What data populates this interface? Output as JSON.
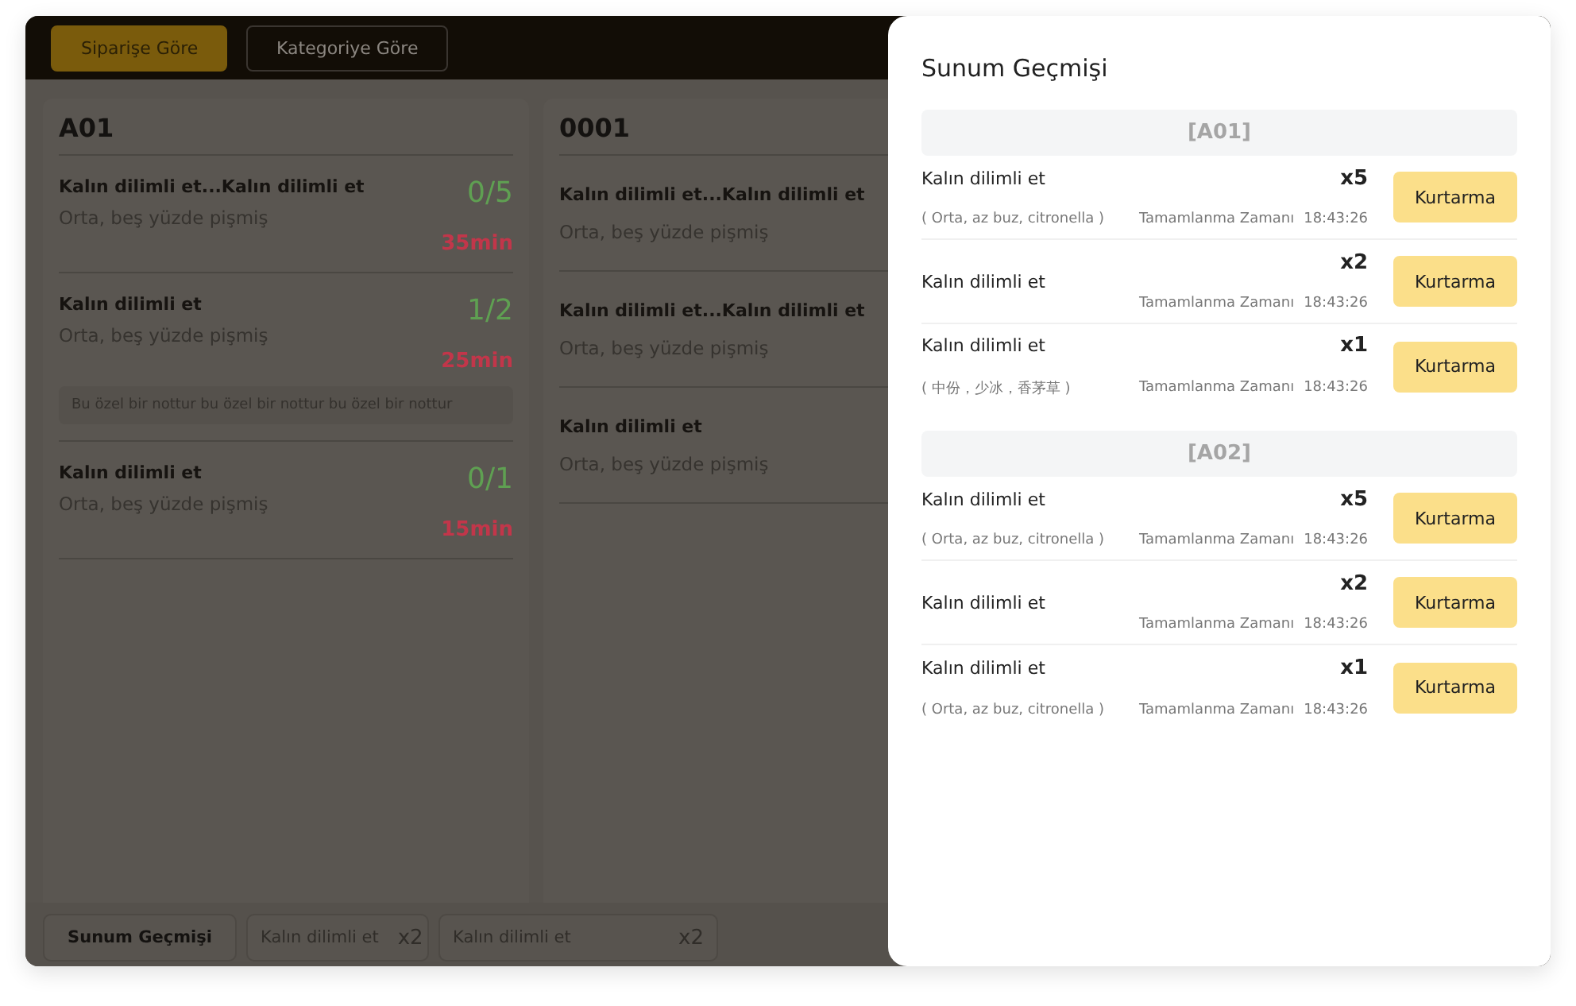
{
  "tabs": [
    {
      "label": "Siparişe Göre",
      "selected": true
    },
    {
      "label": "Kategoriye Göre",
      "selected": false
    }
  ],
  "orders": [
    {
      "title": "A01",
      "items": [
        {
          "name": "Kalın dilimli et...Kalın dilimli et",
          "desc": "Orta, beş yüzde pişmiş",
          "count": "0/5",
          "time": "35min"
        },
        {
          "name": "Kalın dilimli et",
          "desc": "Orta, beş yüzde pişmiş",
          "count": "1/2",
          "time": "25min",
          "note": "Bu özel bir nottur bu özel bir nottur bu özel bir nottur"
        },
        {
          "name": "Kalın dilimli et",
          "desc": "Orta, beş yüzde pişmiş",
          "count": "0/1",
          "time": "15min"
        }
      ]
    },
    {
      "title": "0001",
      "items": [
        {
          "name": "Kalın dilimli et...Kalın dilimli et",
          "desc": "Orta, beş yüzde pişmiş"
        },
        {
          "name": "Kalın dilimli et...Kalın dilimli et",
          "desc": "Orta, beş yüzde pişmiş"
        },
        {
          "name": "Kalın dilimli et",
          "desc": "Orta, beş yüzde pişmiş"
        }
      ]
    }
  ],
  "bottom_bar": {
    "history_button": "Sunum Geçmişi",
    "chips": [
      {
        "name": "Kalın dilimli et",
        "qty": "x2"
      },
      {
        "name": "Kalın dilimli et",
        "qty": "x2"
      }
    ]
  },
  "history": {
    "title": "Sunum Geçmişi",
    "groups": [
      {
        "table": "[A01]",
        "rows": [
          {
            "name": "Kalın dilimli et",
            "options": "( Orta, az buz, citronella )",
            "qty": "x5",
            "time_label": "Tamamlanma Zamanı",
            "time": "18:43:26",
            "button": "Kurtarma"
          },
          {
            "name": "Kalın dilimli et",
            "qty": "x2",
            "time_label": "Tamamlanma Zamanı",
            "time": "18:43:26",
            "button": "Kurtarma"
          },
          {
            "name": "Kalın dilimli et",
            "options": "( 中份，少冰，香茅草 )",
            "qty": "x1",
            "time_label": "Tamamlanma Zamanı",
            "time": "18:43:26",
            "button": "Kurtarma"
          }
        ]
      },
      {
        "table": "[A02]",
        "rows": [
          {
            "name": "Kalın dilimli et",
            "options": "( Orta, az buz, citronella )",
            "qty": "x5",
            "time_label": "Tamamlanma Zamanı",
            "time": "18:43:26",
            "button": "Kurtarma"
          },
          {
            "name": "Kalın dilimli et",
            "qty": "x2",
            "time_label": "Tamamlanma Zamanı",
            "time": "18:43:26",
            "button": "Kurtarma"
          },
          {
            "name": "Kalın dilimli et",
            "options": "( Orta, az buz, citronella )",
            "qty": "x1",
            "time_label": "Tamamlanma Zamanı",
            "time": "18:43:26",
            "button": "Kurtarma"
          }
        ]
      }
    ]
  }
}
